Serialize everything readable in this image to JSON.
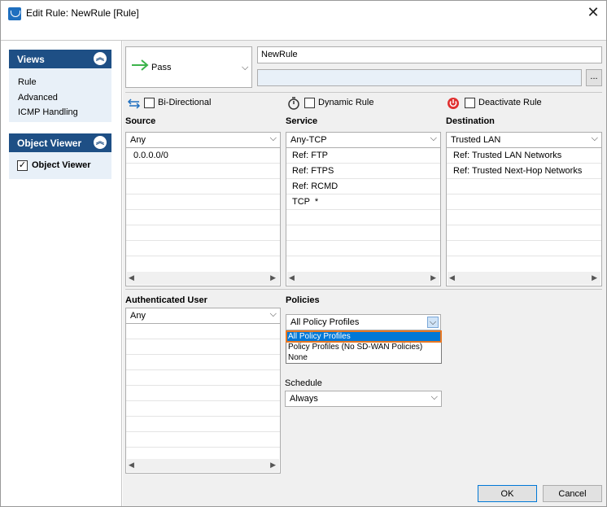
{
  "window": {
    "title": "Edit Rule: NewRule [Rule]"
  },
  "views": {
    "header": "Views",
    "items": [
      "Rule",
      "Advanced",
      "ICMP Handling"
    ]
  },
  "object_viewer": {
    "header": "Object Viewer",
    "checkbox_label": "Object Viewer",
    "checked": true
  },
  "action": {
    "label": "Pass"
  },
  "rule": {
    "name": "NewRule",
    "description": "",
    "more_button": "..."
  },
  "options": {
    "bidirectional": "Bi-Directional",
    "dynamic": "Dynamic Rule",
    "deactivate": "Deactivate Rule"
  },
  "source": {
    "title": "Source",
    "selected": "Any",
    "rows": [
      "0.0.0.0/0"
    ]
  },
  "service": {
    "title": "Service",
    "selected": "Any-TCP",
    "rows": [
      "Ref: FTP",
      "Ref: FTPS",
      "Ref: RCMD",
      "TCP  *"
    ]
  },
  "destination": {
    "title": "Destination",
    "selected": "Trusted LAN",
    "rows": [
      "Ref: Trusted LAN Networks",
      "Ref: Trusted Next-Hop Networks"
    ]
  },
  "auth_user": {
    "title": "Authenticated User",
    "selected": "Any"
  },
  "policies": {
    "title": "Policies",
    "selected": "All Policy Profiles",
    "options": [
      "All Policy Profiles",
      "Policy Profiles (No SD-WAN Policies)",
      "None"
    ]
  },
  "schedule": {
    "title": "Schedule",
    "selected": "Always"
  },
  "buttons": {
    "ok": "OK",
    "cancel": "Cancel"
  },
  "colors": {
    "accent": "#1e4f85",
    "highlight": "#0078d7",
    "focus_outline": "#e87722",
    "pass_arrow": "#3cb44b",
    "deactivate_icon": "#e03030"
  }
}
